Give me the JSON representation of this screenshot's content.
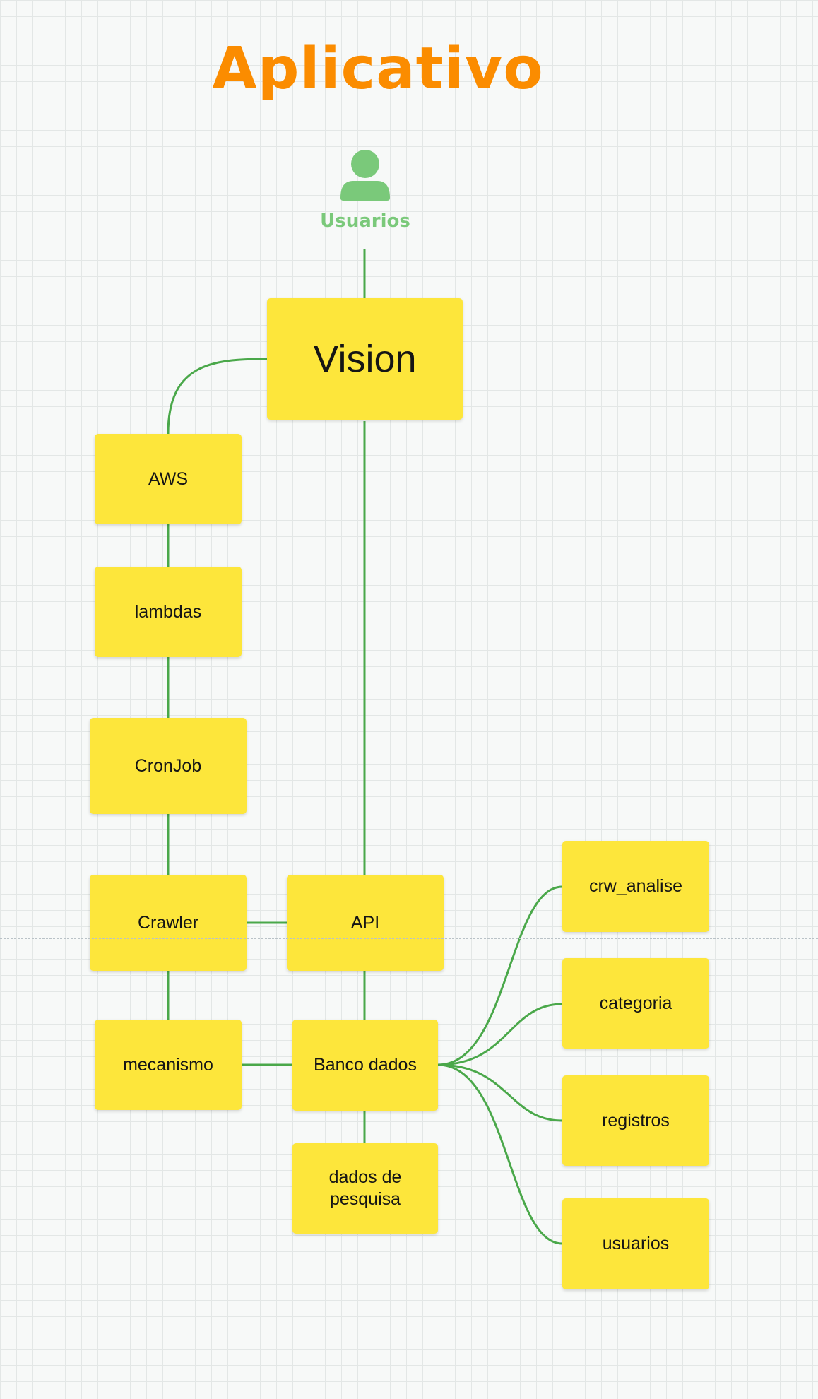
{
  "title": "Aplicativo",
  "users": {
    "label": "Usuarios",
    "icon": "user-icon"
  },
  "colors": {
    "title": "#fb8c00",
    "users": "#7ac97a",
    "connector": "#4aa84a",
    "note": "#fde63b"
  },
  "notes": {
    "vision": "Vision",
    "aws": "AWS",
    "lambdas": "lambdas",
    "cronjob": "CronJob",
    "crawler": "Crawler",
    "api": "API",
    "mecanismo": "mecanismo",
    "banco_dados": "Banco dados",
    "dados_pesquisa": "dados de\npesquisa",
    "crw_analise": "crw_analise",
    "categoria": "categoria",
    "registros": "registros",
    "usuarios": "usuarios"
  }
}
